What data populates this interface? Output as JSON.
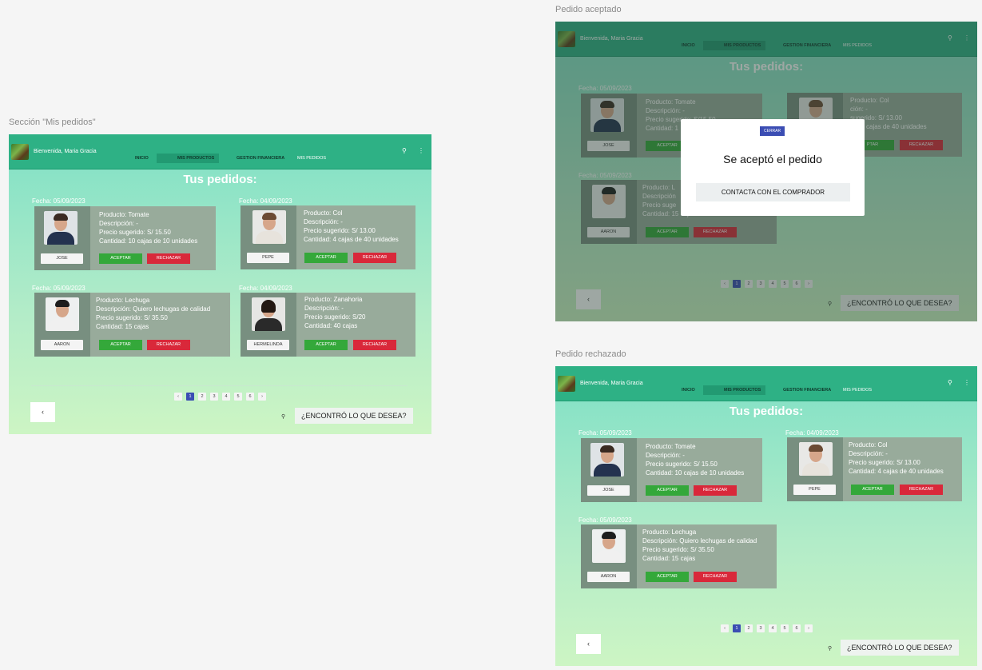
{
  "labels": {
    "section": "Sección \"Mis pedidos\"",
    "accepted": "Pedido aceptado",
    "rejected": "Pedido rechazado"
  },
  "topbar": {
    "welcome": "Bienvenida, Maria Gracia",
    "nav": [
      "INICIO",
      "MIS PRODUCTOS",
      "GESTION FINANCIERA",
      "MIS PEDIDOS"
    ],
    "search_icon": "⚲",
    "menu_icon": "⋮"
  },
  "page_title": "Tus pedidos:",
  "orders": [
    {
      "date": "Fecha: 05/09/2023",
      "name": "JOSE",
      "producto": "Producto: Tomate",
      "descripcion": "Descripción: -",
      "precio": "Precio sugerido: S/ 15.50",
      "cantidad": "Cantidad: 10 cajas de 10 unidades"
    },
    {
      "date": "Fecha: 04/09/2023",
      "name": "PEPE",
      "producto": "Producto: Col",
      "descripcion": "Descripción: -",
      "precio": "Precio sugerido: S/ 13.00",
      "cantidad": "Cantidad: 4 cajas de 40 unidades"
    },
    {
      "date": "Fecha: 05/09/2023",
      "name": "AARON",
      "producto": "Producto: Lechuga",
      "descripcion": "Descripción: Quiero lechugas de calidad",
      "precio": "Precio sugerido: S/ 35.50",
      "cantidad": "Cantidad: 15 cajas"
    },
    {
      "date": "Fecha: 04/09/2023",
      "name": "HERMELINDA",
      "producto": "Producto: Zanahoria",
      "descripcion": "Descripción: -",
      "precio": "Precio sugerido: S/20",
      "cantidad": "Cantidad: 40 cajas"
    }
  ],
  "obscured": {
    "precio": "Precio sugerido: S/15.50",
    "cantidad_prefix": "Cantidad: 1",
    "lechuga_prefix": "Producto: L",
    "desc_prefix": "Descripción",
    "precio_prefix": "Precio suge",
    "cantidad_lechuga": "Cantidad: 15 cajas",
    "desc_col": "ción: -",
    "precio_col": "sugerido: S/ 13.00",
    "cantidad_col": "ad: 4 cajas de 40 unidades",
    "acept_col": "PTAR"
  },
  "buttons": {
    "accept": "ACEPTAR",
    "reject": "RECHAZAR"
  },
  "pages": [
    "‹",
    "1",
    "2",
    "3",
    "4",
    "5",
    "6",
    "›"
  ],
  "back": "‹",
  "search_small": "⚲",
  "find": "¿ENCONTRÓ LO QUE DESEA?",
  "modal": {
    "close": "CERRAR",
    "message": "Se aceptó el pedido",
    "contact": "CONTACTA CON EL COMPRADOR"
  },
  "colors": {
    "accent": "#2eb185",
    "accept": "#34a83a",
    "reject": "#d9283a",
    "pager_active": "#3b4db3"
  }
}
